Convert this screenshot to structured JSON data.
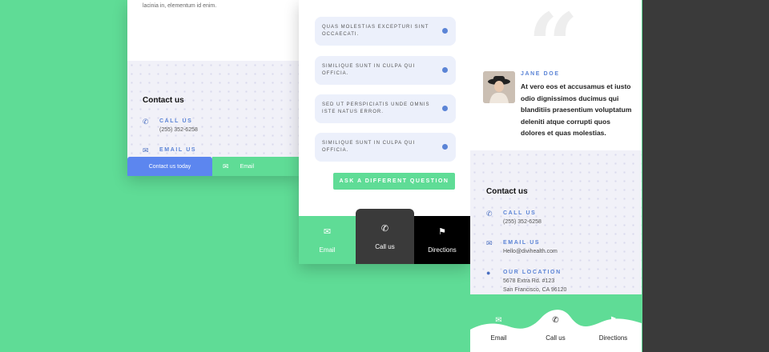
{
  "phone1": {
    "top_text": "lacinia in, elementum id enim.",
    "contact_title": "Contact us",
    "call_label": "CALL US",
    "call_value": "(255) 352-6258",
    "email_label": "EMAIL US",
    "bar": {
      "contact_btn": "Contact us today",
      "email_btn": "Email"
    }
  },
  "phone2": {
    "faqs": [
      {
        "q": "QUAS MOLESTIAS EXCEPTURI SINT OCCAECATI."
      },
      {
        "q": "SIMILIQUE SUNT IN CULPA QUI OFFICIA."
      },
      {
        "q": "SED UT PERSPICIATIS UNDE OMNIS ISTE NATUS ERROR."
      },
      {
        "q": "SIMILIQUE SUNT IN CULPA QUI OFFICIA."
      }
    ],
    "ask_button": "ASK A DIFFERENT QUESTION",
    "tabs": [
      {
        "label": "Email",
        "icon": "envelope-icon"
      },
      {
        "label": "Call us",
        "icon": "phone-icon"
      },
      {
        "label": "Directions",
        "icon": "pin-icon"
      }
    ]
  },
  "phone3": {
    "author": "JANE DOE",
    "testimonial": "At vero eos et accusamus et iusto odio dignissimos ducimus qui blanditiis praesentium voluptatum deleniti atque corrupti quos dolores et quas molestias.",
    "contact_title": "Contact us",
    "call_label": "CALL US",
    "call_value": "(255) 352-6258",
    "email_label": "EMAIL US",
    "email_value": "Hello@divihealth.com",
    "location_label": "OUR LOCATION",
    "location_line1": "5678 Extra Rd. #123",
    "location_line2": "San Francisco, CA 96120",
    "tabs": [
      {
        "label": "Email",
        "icon": "envelope-icon"
      },
      {
        "label": "Call us",
        "icon": "phone-icon"
      },
      {
        "label": "Directions",
        "icon": "pin-icon"
      }
    ]
  },
  "colors": {
    "background": "#5fdc96",
    "accent_blue": "#5c86ef",
    "dark_tab": "#3a3a3a",
    "black_tab": "#000000"
  }
}
